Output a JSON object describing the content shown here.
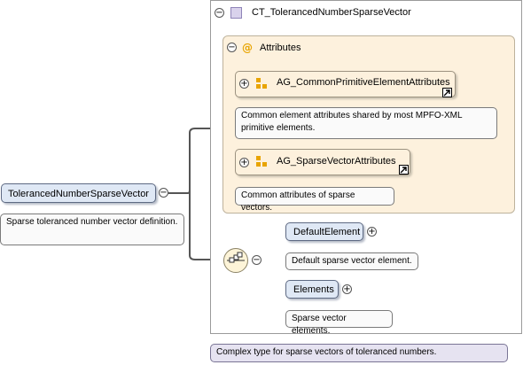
{
  "root": {
    "name": "TolerancedNumberSparseVector",
    "description": "Sparse toleranced number vector definition."
  },
  "complex_type": {
    "name": "CT_TolerancedNumberSparseVector",
    "description": "Complex type for sparse vectors of toleranced numbers."
  },
  "attributes": {
    "icon_symbol": "@",
    "title": "Attributes",
    "groups": [
      {
        "name": "AG_CommonPrimitiveElementAttributes",
        "description": "Common element attributes shared by most MPFO-XML primitive elements."
      },
      {
        "name": "AG_SparseVectorAttributes",
        "description": "Common attributes of sparse vectors."
      }
    ]
  },
  "elements": [
    {
      "name": "DefaultElement",
      "description": "Default sparse vector element."
    },
    {
      "name": "Elements",
      "description": "Sparse vector elements."
    }
  ],
  "colors": {
    "element_fill": "#dfe8f5",
    "group_fill": "#fdf1dd",
    "type_note_fill": "#e6e3f1",
    "connector": "#555555",
    "attribute_icon": "#e8a400"
  },
  "icons": [
    "collapse-minus-icon",
    "expand-plus-icon",
    "complex-type-icon",
    "attribute-at-icon",
    "attribute-group-icon",
    "goto-link-icon",
    "sequence-compositor-icon"
  ]
}
